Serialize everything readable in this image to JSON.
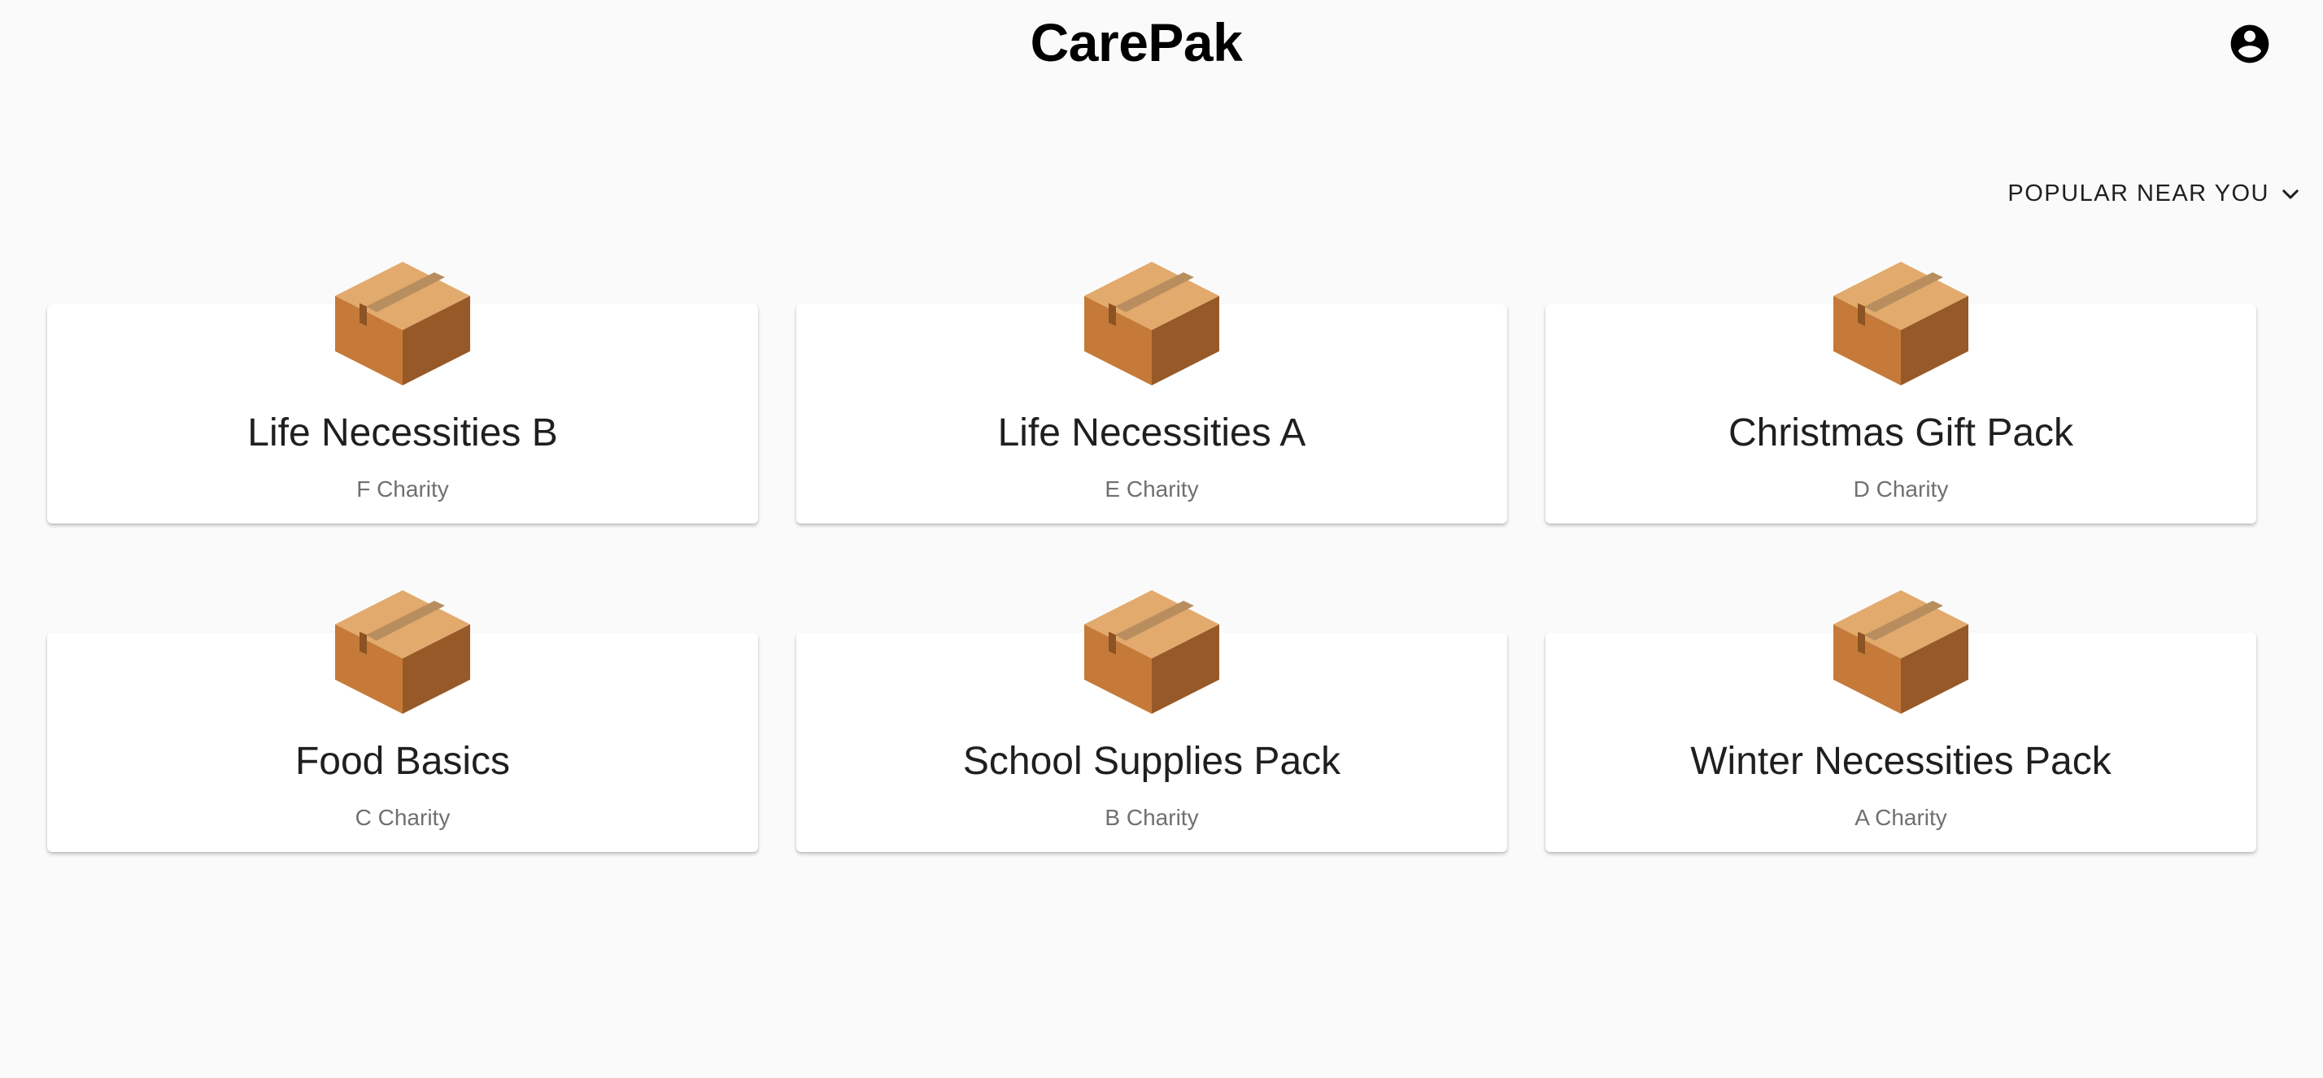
{
  "header": {
    "title": "CarePak",
    "account_icon": "account-circle-icon"
  },
  "sort": {
    "label": "POPULAR NEAR YOU",
    "icon": "chevron-down-icon"
  },
  "packs": [
    {
      "title": "Life Necessities B",
      "charity": "F Charity",
      "icon": "package-box-icon"
    },
    {
      "title": "Life Necessities A",
      "charity": "E Charity",
      "icon": "package-box-icon"
    },
    {
      "title": "Christmas Gift Pack",
      "charity": "D Charity",
      "icon": "package-box-icon"
    },
    {
      "title": "Food Basics",
      "charity": "C Charity",
      "icon": "package-box-icon"
    },
    {
      "title": "School Supplies Pack",
      "charity": "B Charity",
      "icon": "package-box-icon"
    },
    {
      "title": "Winter Necessities Pack",
      "charity": "A Charity",
      "icon": "package-box-icon"
    }
  ],
  "colors": {
    "background": "#fafafa",
    "card": "#ffffff",
    "subtitle": "#707070",
    "box_top": "#e2aa6c",
    "box_left": "#c57a39",
    "box_right": "#975927",
    "box_tape": "#b88e5f"
  }
}
